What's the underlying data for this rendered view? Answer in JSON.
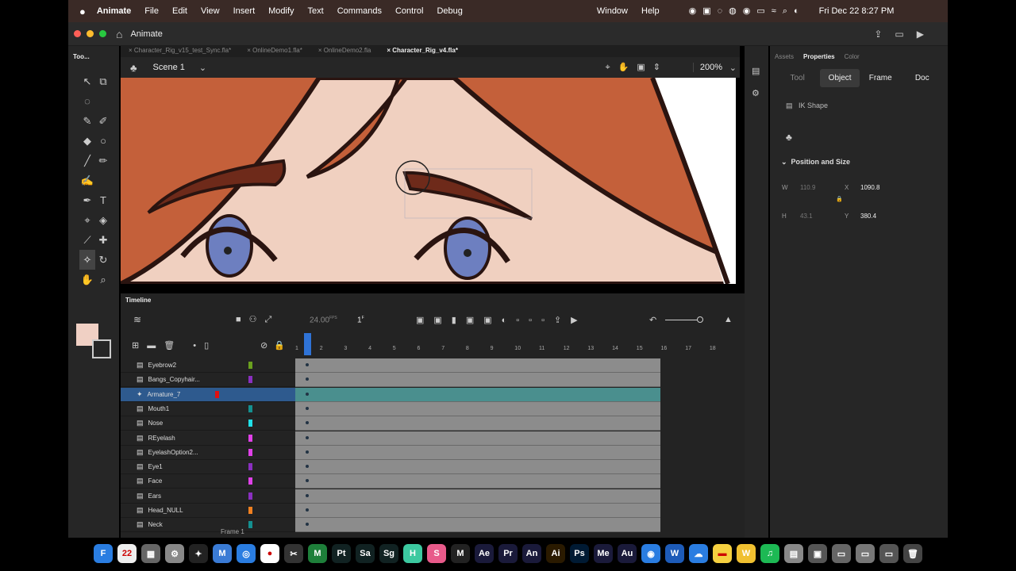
{
  "menubar": {
    "app": "Animate",
    "items": [
      "File",
      "Edit",
      "View",
      "Insert",
      "Modify",
      "Text",
      "Commands",
      "Control",
      "Debug"
    ],
    "right_items": [
      "Window",
      "Help"
    ],
    "clock": "Fri Dec 22  8:27 PM"
  },
  "appbar": {
    "home_label": "Animate"
  },
  "tools": {
    "title": "Too..."
  },
  "tabs": [
    "Character_Rig_v15_test_Sync.fla*",
    "OnlineDemo1.fla*",
    "OnlineDemo2.fla",
    "Character_Rig_v4.fla*"
  ],
  "scene": {
    "label": "Scene 1",
    "zoom": "200%"
  },
  "timeline": {
    "title": "Timeline",
    "fps": "24.00",
    "fps_unit": "FPS",
    "frame": "1",
    "frame_unit": "F",
    "frame_numbers": [
      "1",
      "2",
      "3",
      "4",
      "5",
      "6",
      "7",
      "8",
      "9",
      "10",
      "11",
      "12",
      "13",
      "14",
      "15",
      "16",
      "17",
      "18"
    ],
    "footer": "Frame 1",
    "layers": [
      {
        "name": "Eyebrow2",
        "color": "#6aa01e"
      },
      {
        "name": "Bangs_Copyhair...",
        "color": "#8a2fc0"
      },
      {
        "name": "Armature_7",
        "color": "#e01010"
      },
      {
        "name": "Mouth1",
        "color": "#149090"
      },
      {
        "name": "Nose",
        "color": "#20e0e8"
      },
      {
        "name": "REyelash",
        "color": "#e040e8"
      },
      {
        "name": "EyelashOption2...",
        "color": "#e040e8"
      },
      {
        "name": "Eye1",
        "color": "#8a2fc0"
      },
      {
        "name": "Face",
        "color": "#e040e8"
      },
      {
        "name": "Ears",
        "color": "#8a2fc0"
      },
      {
        "name": "Head_NULL",
        "color": "#f08020"
      },
      {
        "name": "Neck",
        "color": "#149090"
      }
    ]
  },
  "properties": {
    "tabs": [
      "Assets",
      "Properties",
      "Color"
    ],
    "subtabs": [
      "Tool",
      "Object",
      "Frame",
      "Doc"
    ],
    "object_type": "IK Shape",
    "section": "Position and Size",
    "w_label": "W",
    "w": "110.9",
    "x_label": "X",
    "x": "1090.8",
    "h_label": "H",
    "h": "43.1",
    "y_label": "Y",
    "y": "380.4"
  },
  "dock": [
    {
      "l": "F",
      "c": "#2a7de1"
    },
    {
      "l": "22",
      "c": "#eee"
    },
    {
      "l": "▦",
      "c": "#666"
    },
    {
      "l": "⚙",
      "c": "#888"
    },
    {
      "l": "✦",
      "c": "#222"
    },
    {
      "l": "M",
      "c": "#3a7bd5"
    },
    {
      "l": "◎",
      "c": "#2a7de1"
    },
    {
      "l": "●",
      "c": "#fff"
    },
    {
      "l": "✂",
      "c": "#333"
    },
    {
      "l": "M",
      "c": "#1e7f3a"
    },
    {
      "l": "Pt",
      "c": "#122"
    },
    {
      "l": "Sa",
      "c": "#122"
    },
    {
      "l": "Sg",
      "c": "#122"
    },
    {
      "l": "H",
      "c": "#3cc9a0"
    },
    {
      "l": "S",
      "c": "#e85a8a"
    },
    {
      "l": "M",
      "c": "#222"
    },
    {
      "l": "Ae",
      "c": "#1a1a3a"
    },
    {
      "l": "Pr",
      "c": "#1a1a3a"
    },
    {
      "l": "An",
      "c": "#1a1a3a"
    },
    {
      "l": "Ai",
      "c": "#2a1a00"
    },
    {
      "l": "Ps",
      "c": "#001a33"
    },
    {
      "l": "Me",
      "c": "#1a1a3a"
    },
    {
      "l": "Au",
      "c": "#1a1a3a"
    },
    {
      "l": "◉",
      "c": "#2a7de1"
    },
    {
      "l": "W",
      "c": "#1d5bb8"
    },
    {
      "l": "☁",
      "c": "#2a7de1"
    },
    {
      "l": "▬",
      "c": "#f5d040"
    },
    {
      "l": "W",
      "c": "#f0c030"
    },
    {
      "l": "♫",
      "c": "#1db954"
    },
    {
      "l": "▤",
      "c": "#888"
    },
    {
      "l": "▣",
      "c": "#555"
    },
    {
      "l": "▭",
      "c": "#666"
    },
    {
      "l": "▭",
      "c": "#777"
    },
    {
      "l": "▭",
      "c": "#555"
    },
    {
      "l": "🗑",
      "c": "#444"
    }
  ]
}
